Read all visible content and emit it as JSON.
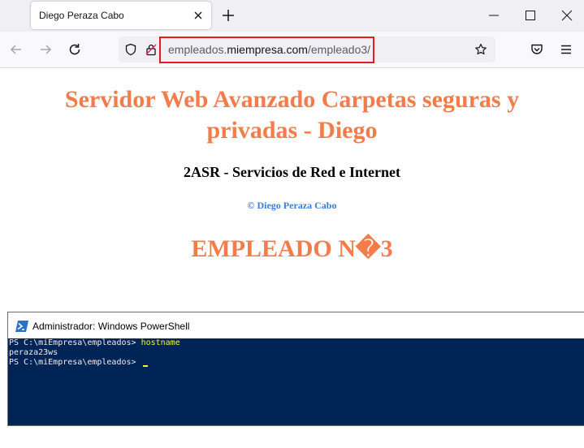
{
  "browser": {
    "tab_title": "Diego Peraza Cabo",
    "url_prefix": "empleados.",
    "url_host": "miempresa.com",
    "url_path": "/empleado3/"
  },
  "page": {
    "main_heading": "Servidor Web Avanzado Carpetas seguras y privadas - Diego",
    "subtitle": "2ASR - Servicios de Red e Internet",
    "copyright": "© Diego Peraza Cabo",
    "employee_heading": "EMPLEADO N�3",
    "heading_color": "#f47c4b",
    "link_color": "#3a7fdc"
  },
  "powershell": {
    "title": "Administrador: Windows PowerShell",
    "prompt1": "PS C:\\miEmpresa\\empleados> ",
    "command1": "hostname",
    "output1": "peraza23ws",
    "prompt2": "PS C:\\miEmpresa\\empleados> ",
    "background_color": "#012456"
  }
}
